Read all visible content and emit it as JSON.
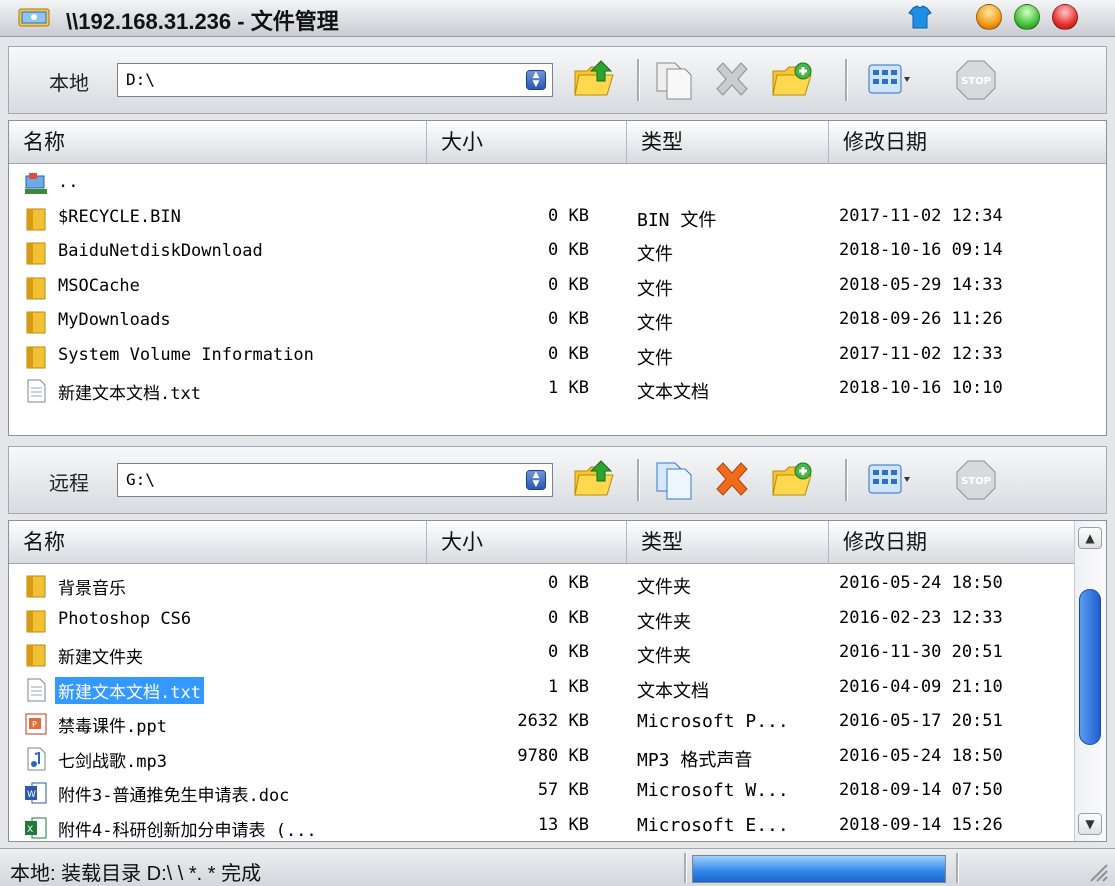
{
  "window": {
    "title": "\\\\192.168.31.236 - 文件管理"
  },
  "local": {
    "label": "本地",
    "path": "D:\\",
    "columns": [
      "名称",
      "大小",
      "类型",
      "修改日期"
    ],
    "rows": [
      {
        "icon": "computer-icon",
        "name": "..",
        "size": "",
        "type": "",
        "date": ""
      },
      {
        "icon": "folder-icon",
        "name": "$RECYCLE.BIN",
        "size": "0 KB",
        "type": "BIN 文件",
        "date": "2017-11-02 12:34"
      },
      {
        "icon": "folder-icon",
        "name": "BaiduNetdiskDownload",
        "size": "0 KB",
        "type": "文件",
        "date": "2018-10-16 09:14"
      },
      {
        "icon": "folder-icon",
        "name": "MSOCache",
        "size": "0 KB",
        "type": "文件",
        "date": "2018-05-29 14:33"
      },
      {
        "icon": "folder-icon",
        "name": "MyDownloads",
        "size": "0 KB",
        "type": "文件",
        "date": "2018-09-26 11:26"
      },
      {
        "icon": "folder-icon",
        "name": "System Volume Information",
        "size": "0 KB",
        "type": "文件",
        "date": "2017-11-02 12:33"
      },
      {
        "icon": "text-file-icon",
        "name": "新建文本文档.txt",
        "size": "1 KB",
        "type": "文本文档",
        "date": "2018-10-16 10:10"
      }
    ]
  },
  "remote": {
    "label": "远程",
    "path": "G:\\",
    "columns": [
      "名称",
      "大小",
      "类型",
      "修改日期"
    ],
    "rows": [
      {
        "icon": "folder-icon",
        "name": "背景音乐",
        "size": "0 KB",
        "type": "文件夹",
        "date": "2016-05-24 18:50"
      },
      {
        "icon": "folder-icon",
        "name": "Photoshop CS6",
        "size": "0 KB",
        "type": "文件夹",
        "date": "2016-02-23 12:33"
      },
      {
        "icon": "folder-icon",
        "name": "新建文件夹",
        "size": "0 KB",
        "type": "文件夹",
        "date": "2016-11-30 20:51"
      },
      {
        "icon": "text-file-icon",
        "name": "新建文本文档.txt",
        "size": "1 KB",
        "type": "文本文档",
        "date": "2016-04-09 21:10",
        "selected": true
      },
      {
        "icon": "ppt-file-icon",
        "name": "禁毒课件.ppt",
        "size": "2632 KB",
        "type": "Microsoft P...",
        "date": "2016-05-17 20:51"
      },
      {
        "icon": "mp3-file-icon",
        "name": "七剑战歌.mp3",
        "size": "9780 KB",
        "type": "MP3 格式声音",
        "date": "2016-05-24 18:50"
      },
      {
        "icon": "word-file-icon",
        "name": "附件3-普通推免生申请表.doc",
        "size": "57 KB",
        "type": "Microsoft W...",
        "date": "2018-09-14 07:50"
      },
      {
        "icon": "excel-file-icon",
        "name": "附件4-科研创新加分申请表 (...",
        "size": "13 KB",
        "type": "Microsoft E...",
        "date": "2018-09-14 15:26"
      }
    ]
  },
  "status": {
    "text": "本地: 装载目录 D:\\ \\ *. * 完成",
    "progress": 1.0
  },
  "colors": {
    "selection": "#3399ff",
    "progress": "#2f86e8"
  }
}
